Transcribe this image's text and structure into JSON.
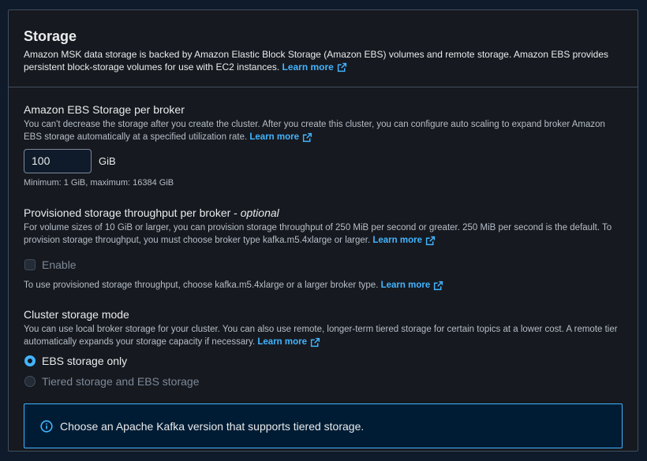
{
  "storage": {
    "title": "Storage",
    "description": "Amazon MSK data storage is backed by Amazon Elastic Block Storage (Amazon EBS) volumes and remote storage. Amazon EBS provides persistent block-storage volumes for use with EC2 instances.",
    "learn_more": "Learn more"
  },
  "ebs": {
    "label": "Amazon EBS Storage per broker",
    "description": "You can't decrease the storage after you create the cluster. After you create this cluster, you can configure auto scaling to expand broker Amazon EBS storage automatically at a specified utilization rate.",
    "learn_more": "Learn more",
    "value": "100",
    "unit": "GiB",
    "constraint": "Minimum: 1 GiB, maximum: 16384 GiB"
  },
  "throughput": {
    "label": "Provisioned storage throughput per broker - ",
    "optional": "optional",
    "description": "For volume sizes of 10 GiB or larger, you can provision storage throughput of 250 MiB per second or greater. 250 MiB per second is the default. To provision storage throughput, you must choose broker type kafka.m5.4xlarge or larger.",
    "learn_more": "Learn more",
    "checkbox_label": "Enable",
    "note": "To use provisioned storage throughput, choose kafka.m5.4xlarge or a larger broker type.",
    "note_learn_more": "Learn more"
  },
  "mode": {
    "label": "Cluster storage mode",
    "description": "You can use local broker storage for your cluster. You can also use remote, longer-term tiered storage for certain topics at a lower cost. A remote tier automatically expands your storage capacity if necessary.",
    "learn_more": "Learn more",
    "options": [
      {
        "label": "EBS storage only",
        "selected": true,
        "disabled": false
      },
      {
        "label": "Tiered storage and EBS storage",
        "selected": false,
        "disabled": true
      }
    ]
  },
  "alert": {
    "text": "Choose an Apache Kafka version that supports tiered storage."
  },
  "colors": {
    "accent": "#42b4ff",
    "panel_bg": "#16191f",
    "border": "#414d5c",
    "text": "#e9ebed",
    "muted": "#b6bec9"
  },
  "icons": {
    "external_link": "external-link-icon",
    "info": "info-icon"
  }
}
